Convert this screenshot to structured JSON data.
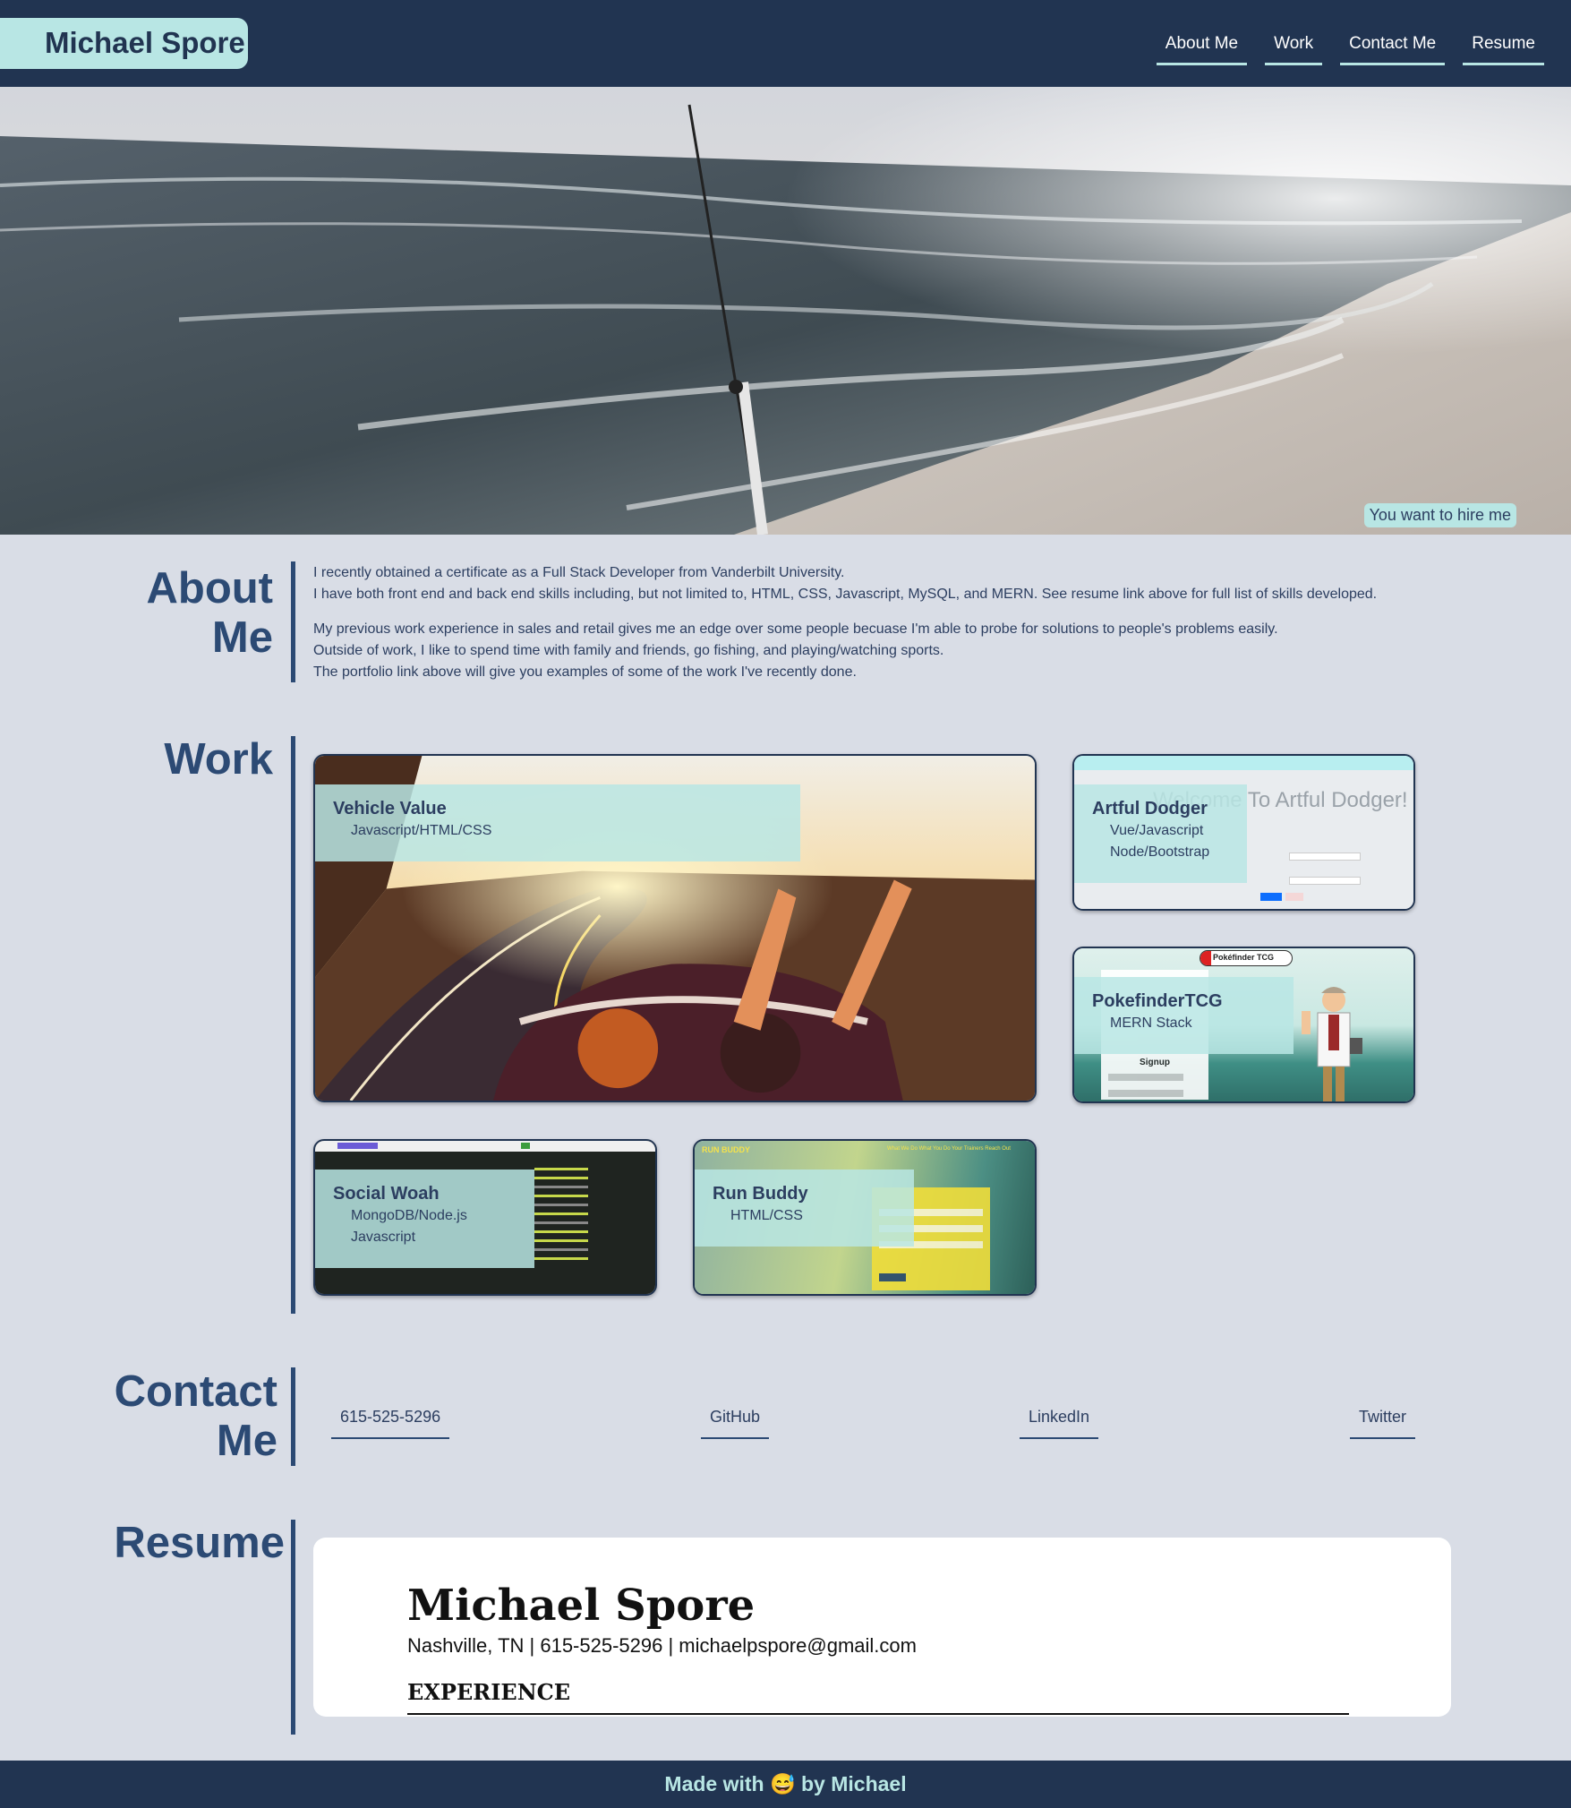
{
  "header": {
    "brand": "Michael Spore",
    "nav": [
      "About Me",
      "Work",
      "Contact Me",
      "Resume"
    ]
  },
  "hero": {
    "hire_text": "You want to hire me"
  },
  "about": {
    "title_line1": "About",
    "title_line2": "Me",
    "p1_line1": "I recently obtained a certificate as a Full Stack Developer from Vanderbilt University.",
    "p1_line2": "I have both front end and back end skills including, but not limited to, HTML, CSS, Javascript, MySQL, and MERN. See resume link above for full list of skills developed.",
    "p2_line1": "My previous work experience in sales and retail gives me an edge over some people becuase I'm able to probe for solutions to people's problems easily.",
    "p2_line2": "Outside of work, I like to spend time with family and friends, go fishing, and playing/watching sports.",
    "p2_line3": "The portfolio link above will give you examples of some of the work I've recently done."
  },
  "work": {
    "title": "Work",
    "projects": [
      {
        "title": "Vehicle Value",
        "tech": [
          "Javascript/HTML/CSS"
        ]
      },
      {
        "title": "Artful Dodger",
        "tech": [
          "Vue/Javascript",
          "Node/Bootstrap"
        ],
        "screenshot_heading": "Welcome To Artful Dodger!"
      },
      {
        "title": "PokefinderTCG",
        "tech": [
          "MERN Stack"
        ],
        "screenshot_logo": "Pokéfinder TCG",
        "screenshot_form": "Signup"
      },
      {
        "title": "Social Woah",
        "tech": [
          "MongoDB/Node.js",
          "Javascript"
        ]
      },
      {
        "title": "Run Buddy",
        "tech": [
          "HTML/CSS"
        ],
        "screenshot_logo": "RUN BUDDY",
        "screenshot_nav": "What We Do   What You Do   Your Trainers   Reach Out"
      }
    ]
  },
  "contact": {
    "title_line1": "Contact",
    "title_line2": "Me",
    "links": [
      "615-525-5296",
      "GitHub",
      "LinkedIn",
      "Twitter"
    ]
  },
  "resume": {
    "title": "Resume",
    "name": "Michael Spore",
    "contact_line": "Nashville, TN | 615-525-5296 | michaelpspore@gmail.com",
    "section": "EXPERIENCE"
  },
  "footer": {
    "text": "Made with 😅 by Michael"
  },
  "colors": {
    "navy": "#213451",
    "mint": "#b8e6e4",
    "page_bg": "#d9dde6",
    "heading": "#2c4a74"
  }
}
